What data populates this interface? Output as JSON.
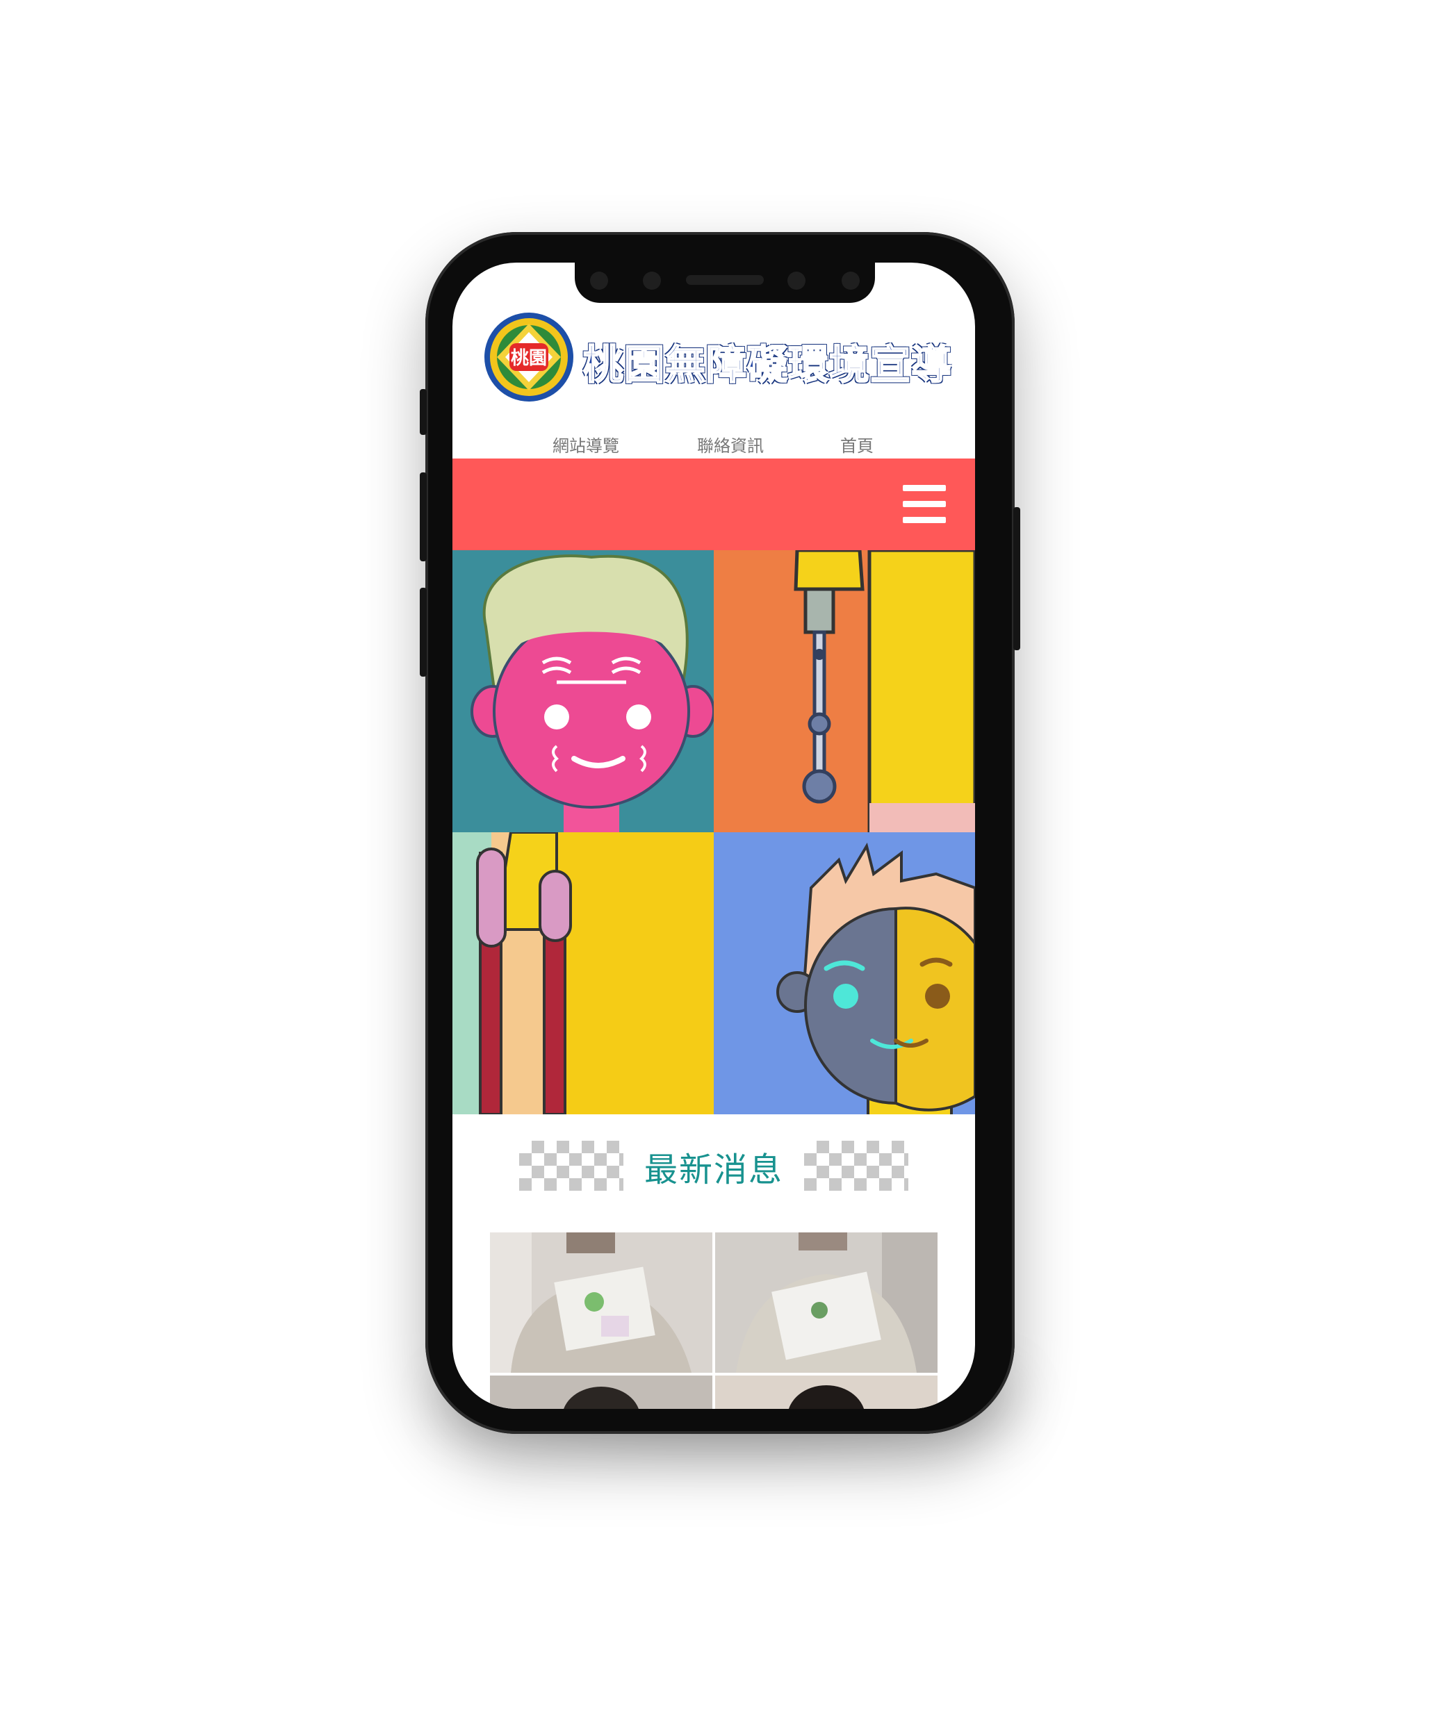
{
  "site": {
    "logo_text": "桃園",
    "title": "桃園無障礙環境宣導"
  },
  "top_nav": [
    {
      "label": "網站導覽"
    },
    {
      "label": "聯絡資訊"
    },
    {
      "label": "首頁"
    }
  ],
  "menu": {
    "icon": "hamburger-menu-icon"
  },
  "news": {
    "heading": "最新消息"
  },
  "colors": {
    "menu_bar": "#ff5858",
    "news_heading": "#18928f",
    "logo_title": "#2346a4"
  }
}
